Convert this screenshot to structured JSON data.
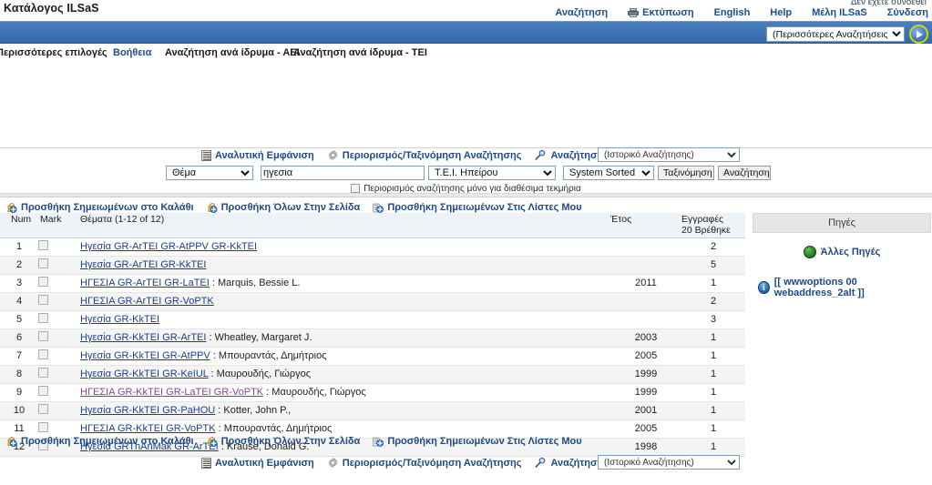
{
  "header": {
    "logo": "Κατάλογος ILSaS",
    "status": "Δεν έχετε συνδεθεί",
    "nav": [
      {
        "label": "Αναζήτηση",
        "icon": null
      },
      {
        "label": "Εκτύπωση",
        "icon": "printer-icon"
      },
      {
        "label": "English",
        "icon": null
      },
      {
        "label": "Help",
        "icon": null
      },
      {
        "label": "Μέλη ILSaS",
        "icon": null
      },
      {
        "label": "Σύνδεση",
        "icon": null
      }
    ],
    "more_searches_value": "(Περισσότερες Αναζητήσεις)",
    "go_button": "go-arrow-icon"
  },
  "subnav": [
    {
      "label": "Περισσότερες επιλογές",
      "style": "plain"
    },
    {
      "label": "Βοήθεια",
      "style": "link"
    },
    {
      "label": "Αναζήτηση ανά ίδρυμα - ΑΕΙ",
      "style": "plain"
    },
    {
      "label": "Αναζήτηση ανά ίδρυμα - ΤΕΙ",
      "style": "plain"
    }
  ],
  "toolbar": {
    "items": [
      {
        "label": "Αναλυτική Εμφάνιση",
        "icon": "detail-view-icon"
      },
      {
        "label": "Περιορισμός/Ταξινόμηση Αναζήτησης",
        "icon": "gear-icon"
      },
      {
        "label": "Αναζήτηση ως Λέξεις",
        "icon": "magnifier-icon"
      }
    ],
    "history_value": "(Ιστορικό Αναζήτησης)"
  },
  "search_form": {
    "field_value": "Θέμα",
    "query_value": "ηγεσια",
    "institution_value": "Τ.Ε.Ι. Ηπείρου",
    "sort_value": "System Sorted",
    "sort_button": "Ταξινόμηση",
    "search_button": "Αναζήτηση",
    "available_only_label": "Περιορισμός αναζήτησης μόνο για διαθέσιμα τεκμήρια"
  },
  "actions": [
    {
      "label": "Προσθήκη Σημειωμένων στο Καλάθι",
      "icon": "cart-add-icon"
    },
    {
      "label": "Προσθήκη Όλων Στην Σελίδα",
      "icon": "page-add-icon"
    },
    {
      "label": "Προσθήκη Σημειωμένων Στις Λίστες Μου",
      "icon": "lists-add-icon"
    }
  ],
  "table": {
    "columns": {
      "num": "Num",
      "mark": "Mark",
      "title": "Θέματα (1-12 of 12)",
      "year": "Έτος",
      "entries": "Εγγραφές",
      "entries_sub": "20 Βρέθηκε"
    },
    "rows": [
      {
        "num": "1",
        "title": "Ηγεσία GR-ArTEI GR-AtPPV GR-KkTEI",
        "author": "",
        "year": "",
        "entries": "2",
        "visited": false
      },
      {
        "num": "2",
        "title": "Ηγεσία GR-ArTEI GR-KkTEI",
        "author": "",
        "year": "",
        "entries": "5",
        "visited": false
      },
      {
        "num": "3",
        "title": "ΗΓΕΣΙΑ GR-ArTEI GR-LaTEI",
        "author": " : Marquis, Bessie L.",
        "year": "2011",
        "entries": "1",
        "visited": false
      },
      {
        "num": "4",
        "title": "ΗΓΕΣΙΑ GR-ArTEI GR-VoPTK",
        "author": "",
        "year": "",
        "entries": "2",
        "visited": false
      },
      {
        "num": "5",
        "title": "Ηγεσία GR-KkTEI",
        "author": "",
        "year": "",
        "entries": "3",
        "visited": false
      },
      {
        "num": "6",
        "title": "Ηγεσία GR-KkTEI GR-ArTEI",
        "author": " : Wheatley, Margaret J.",
        "year": "2003",
        "entries": "1",
        "visited": false
      },
      {
        "num": "7",
        "title": "Ηγεσία GR-KkTEI GR-AtPPV",
        "author": " : Μπουραντάς, Δημήτριος",
        "year": "2005",
        "entries": "1",
        "visited": false
      },
      {
        "num": "8",
        "title": "Ηγεσία GR-KkTEI GR-KeIUL",
        "author": " : Μαυρουδής, Γιώργος",
        "year": "1999",
        "entries": "1",
        "visited": false
      },
      {
        "num": "9",
        "title": "ΗΓΕΣΙΑ GR-KkTEI GR-LaTEI GR-VoPTK",
        "author": " : Μαυρουδής, Γιώργος",
        "year": "1999",
        "entries": "1",
        "visited": true
      },
      {
        "num": "10",
        "title": "Ηγεσία GR-KkTEI GR-PaHOU",
        "author": " : Kotter, John P.,",
        "year": "2001",
        "entries": "1",
        "visited": false
      },
      {
        "num": "11",
        "title": "ΗΓΕΣΙΑ GR-KkTEI GR-VoPTK",
        "author": " : Μπουραντάς, Δημήτριος",
        "year": "2005",
        "entries": "1",
        "visited": false
      },
      {
        "num": "12",
        "title": "Ηγεσία GRThAnMak GR-ArTEI",
        "author": " : Krause, Donald G.",
        "year": "1998",
        "entries": "1",
        "visited": false
      }
    ]
  },
  "sidebar": {
    "title": "Πηγές",
    "other_sources": "Άλλες Πηγές",
    "info_link": "[[ wwwoptions 00 webaddress_2alt ]]",
    "info_icon": "i"
  },
  "colors": {
    "header_blue": "#3a75b8",
    "link_blue": "#1c4a86",
    "visited_link": "#8d3f9e",
    "row_alt": "#f4f4f4",
    "table_header_bg": "#eef3f8"
  }
}
